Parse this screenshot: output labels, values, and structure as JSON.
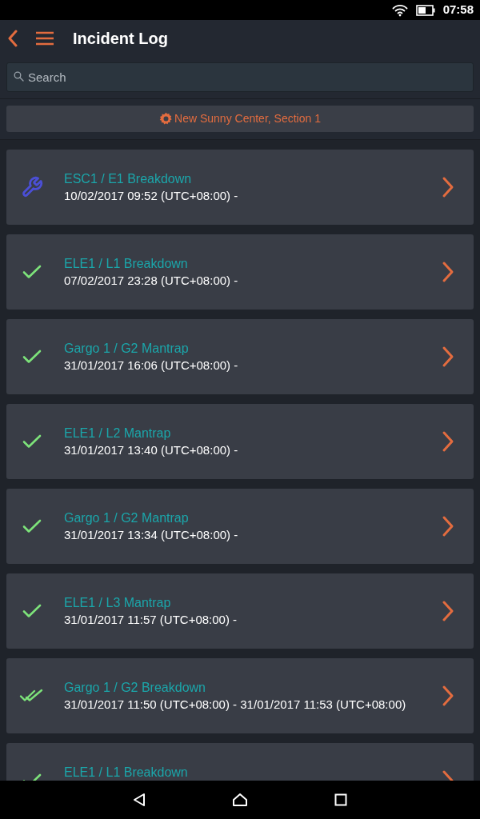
{
  "status_bar": {
    "time": "07:58"
  },
  "header": {
    "title": "Incident Log"
  },
  "search": {
    "placeholder": "Search"
  },
  "location": {
    "label": "New Sunny Center, Section 1"
  },
  "incidents": [
    {
      "kind": "repair",
      "title": "ESC1 / E1 Breakdown",
      "period": "10/02/2017 09:52 (UTC+08:00) -"
    },
    {
      "kind": "resolved",
      "title": "ELE1 / L1 Breakdown",
      "period": "07/02/2017 23:28 (UTC+08:00) -"
    },
    {
      "kind": "resolved",
      "title": "Gargo 1 / G2 Mantrap",
      "period": "31/01/2017 16:06 (UTC+08:00) -"
    },
    {
      "kind": "resolved",
      "title": "ELE1 / L2 Mantrap",
      "period": "31/01/2017 13:40 (UTC+08:00) -"
    },
    {
      "kind": "resolved",
      "title": "Gargo 1 / G2 Mantrap",
      "period": "31/01/2017 13:34 (UTC+08:00) -"
    },
    {
      "kind": "resolved",
      "title": "ELE1 / L3 Mantrap",
      "period": "31/01/2017 11:57 (UTC+08:00) -"
    },
    {
      "kind": "closed",
      "title": "Gargo 1 / G2 Breakdown",
      "period": "31/01/2017 11:50 (UTC+08:00) - 31/01/2017 11:53 (UTC+08:00)"
    },
    {
      "kind": "resolved",
      "title": "ELE1 / L1 Breakdown"
    }
  ]
}
